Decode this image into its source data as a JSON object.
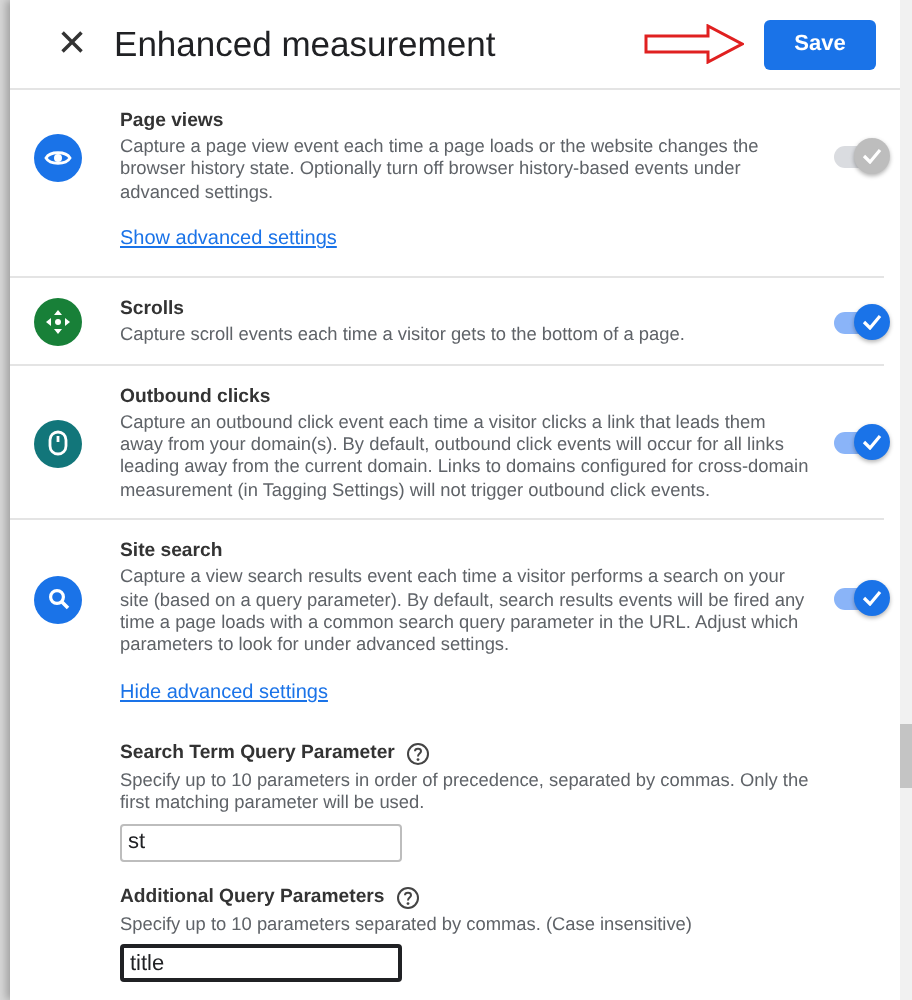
{
  "header": {
    "close": "×",
    "title": "Enhanced measurement",
    "save_button": "Save"
  },
  "events": [
    {
      "title": "Page views",
      "description": "Capture a page view event each time a page loads or the website changes the browser history state. Optionally turn off browser history-based events under advanced settings.",
      "color": "#1a73e8",
      "on": true,
      "disabled": true,
      "link": "Show advanced settings"
    },
    {
      "title": "Scrolls",
      "description": "Capture scroll events each time a visitor gets to the bottom of a page.",
      "color": "#188038",
      "on": true,
      "disabled": false
    },
    {
      "title": "Outbound clicks",
      "description": "Capture an outbound click event each time a visitor clicks a link that leads them away from your domain(s). By default, outbound click events will occur for all links leading away from the current domain. Links to domains configured for cross-domain measurement (in Tagging Settings) will not trigger outbound click events.",
      "color": "#12767a",
      "on": true,
      "disabled": false
    },
    {
      "title": "Site search",
      "description": "Capture a view search results event each time a visitor performs a search on your site (based on a query parameter). By default, search results events will be fired any time a page loads with a common search query parameter in the URL. Adjust which parameters to look for under advanced settings.",
      "color": "#1a73e8",
      "on": true,
      "disabled": false,
      "link": "Hide advanced settings"
    }
  ],
  "parameters": [
    {
      "label": "Search Term Query Parameter",
      "hint": "Specify up to 10 parameters in order of precedence, separated by commas. Only the first matching parameter will be used.",
      "value": "st",
      "focused": false
    },
    {
      "label": "Additional Query Parameters",
      "hint": "Specify up to 10 parameters separated by commas. (Case insensitive)",
      "value": "title",
      "focused": true
    }
  ]
}
